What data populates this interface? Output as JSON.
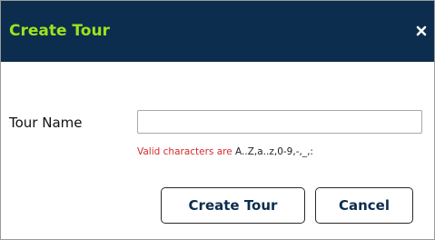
{
  "dialog": {
    "title": "Create Tour",
    "close_icon": "close-icon"
  },
  "form": {
    "tour_name_label": "Tour Name",
    "tour_name_value": "",
    "tour_name_placeholder": "",
    "hint_prefix": "Valid characters are ",
    "hint_chars": "A..Z,a..z,0-9,-,_,:"
  },
  "buttons": {
    "create_label": "Create Tour",
    "cancel_label": "Cancel"
  },
  "colors": {
    "titlebar_bg": "#0c2d4e",
    "title_text": "#9be41c",
    "hint_red": "#d62b2b"
  }
}
